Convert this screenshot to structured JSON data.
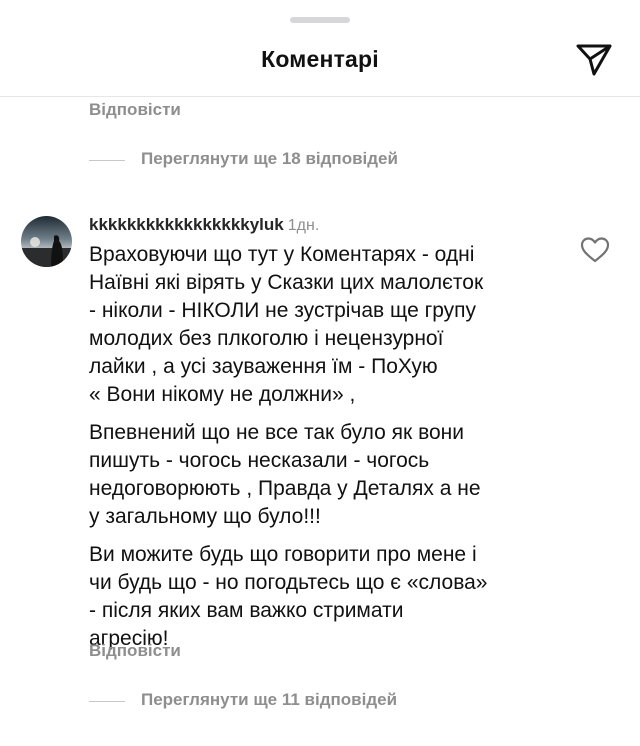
{
  "header": {
    "title": "Коментарі",
    "send_icon": "paper-plane-icon"
  },
  "top": {
    "reply_label": "Відповісти",
    "view_replies_label": "Переглянути ще 18 відповідей"
  },
  "comment": {
    "avatar_icon": "user-avatar",
    "username": "kkkkkkkkkkkkkkkkkyluk",
    "timestamp": "1дн.",
    "like_icon": "heart-icon",
    "paragraphs": [
      [
        "Враховуючи що тут у Коментарях - одні",
        "Наївні які вірять у Сказки цих малолєток",
        "- ніколи - НІКОЛИ не зустрічав ще групу",
        "молодих без плкоголю і нецензурної",
        "лайки , а усі зауваження їм - ПоХую",
        "« Вони нікому не должни» ,"
      ],
      [
        "Впевнений що не все так було як вони",
        "пишуть - чогось несказали - чогось",
        "недоговорюють , Правда у Деталях а не",
        "у загальному що було!!!"
      ],
      [
        "Ви можите будь що говорити про мене і",
        "чи будь що - но погодьтесь що є «слова»",
        "- після яких вам важко стримати",
        "агресію!"
      ]
    ],
    "reply_label": "Відповісти",
    "view_replies_label": "Переглянути ще 11 відповідей"
  },
  "colors": {
    "text": "#111111",
    "secondary": "#8e8e8e",
    "divider": "#e6e6e6",
    "background": "#ffffff"
  }
}
